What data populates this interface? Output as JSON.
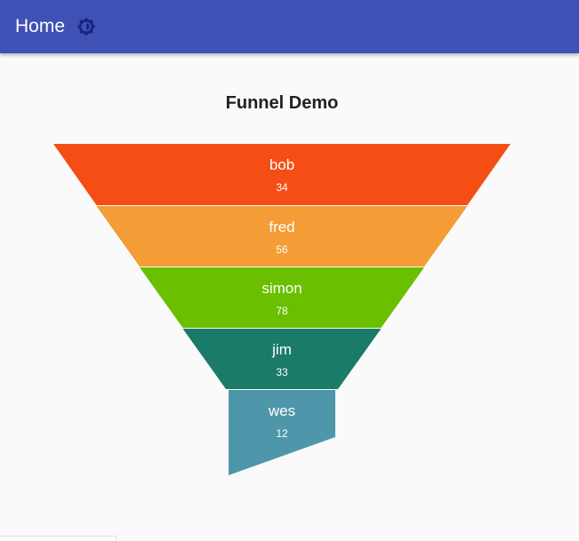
{
  "appbar": {
    "title": "Home",
    "theme_icon": "brightness-icon",
    "background": "#3f51b5"
  },
  "chart_data": {
    "type": "funnel",
    "title": "Funnel Demo",
    "series": [
      {
        "label": "bob",
        "value": 34,
        "color": "#f44e15"
      },
      {
        "label": "fred",
        "value": 56,
        "color": "#f49c35"
      },
      {
        "label": "simon",
        "value": 78,
        "color": "#69bf00"
      },
      {
        "label": "jim",
        "value": 33,
        "color": "#1a7b68"
      },
      {
        "label": "wes",
        "value": 12,
        "color": "#4e97ab"
      }
    ]
  }
}
